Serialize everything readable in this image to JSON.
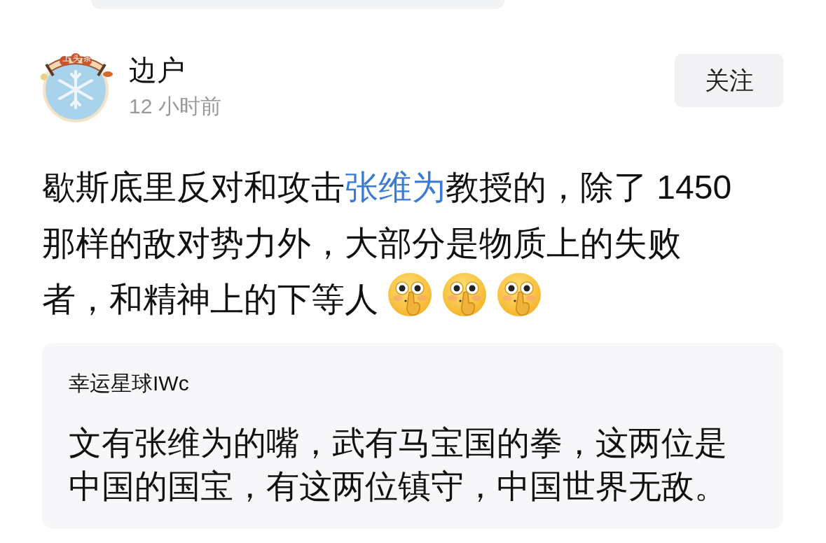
{
  "author": {
    "name": "边户",
    "time": "12 小时前",
    "avatar_badge": "上头条"
  },
  "follow_button": {
    "label": "关注"
  },
  "post": {
    "lines": [
      {
        "segments": [
          {
            "kind": "plain",
            "text": "歇斯底里反对和攻击"
          },
          {
            "kind": "mention",
            "text": "张维为"
          },
          {
            "kind": "plain",
            "text": "教授的，除了 1450"
          }
        ]
      },
      {
        "segments": [
          {
            "kind": "plain",
            "text": "那样的敌对势力外，大部分是物质上的失败"
          }
        ]
      },
      {
        "segments": [
          {
            "kind": "plain",
            "text": "者，和精神上的下等人"
          }
        ]
      }
    ],
    "emojis": [
      {
        "kind": "shush"
      },
      {
        "kind": "shush"
      },
      {
        "kind": "shush"
      }
    ]
  },
  "quote": {
    "author": "幸运星球IWc",
    "text": "文有张维为的嘴，武有马宝国的拳，这两位是中国的国宝，有这两位镇守，中国世界无敌。"
  }
}
